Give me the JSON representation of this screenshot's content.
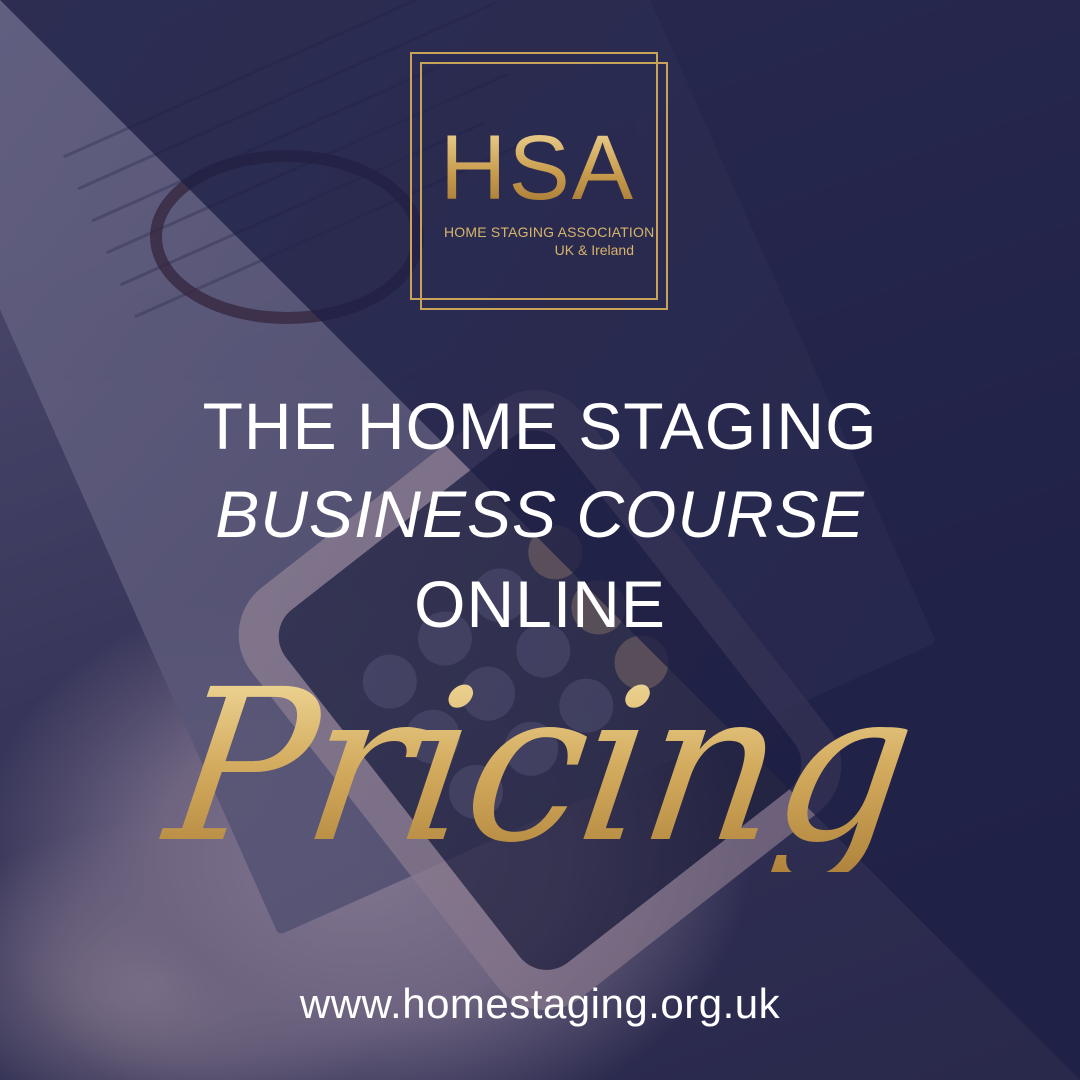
{
  "logo": {
    "mark": "HSA",
    "organization": "HOME STAGING ASSOCIATION",
    "region": "UK & Ireland"
  },
  "headline": {
    "line1": "THE HOME STAGING",
    "line2": "BUSINESS COURSE",
    "line3": "ONLINE"
  },
  "script_word": "Pricing",
  "website": "www.homestaging.org.uk",
  "colors": {
    "navy": "#1e1f46",
    "gold": "#c9a35a",
    "text": "#ffffff"
  }
}
